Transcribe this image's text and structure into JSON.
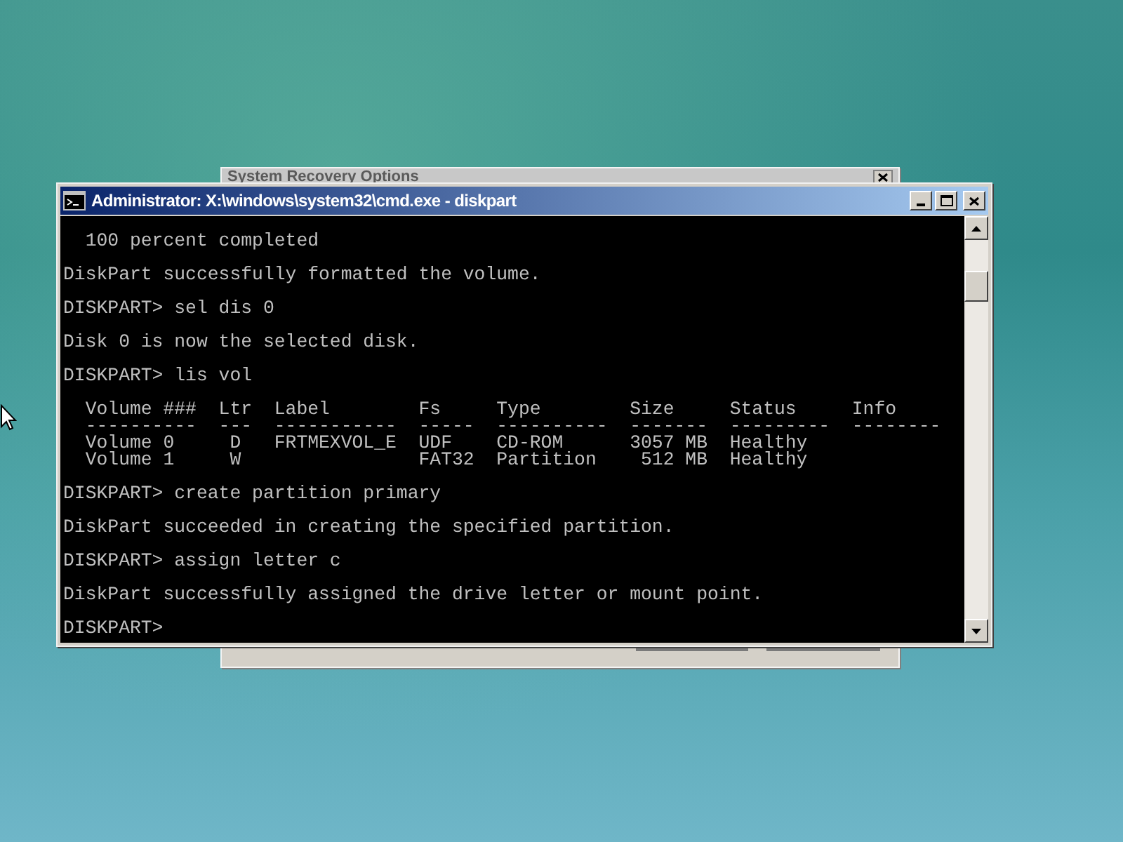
{
  "background_window": {
    "title": "System Recovery Options"
  },
  "console_window": {
    "title": "Administrator: X:\\windows\\system32\\cmd.exe - diskpart",
    "blocks": [
      [
        "  100 percent completed"
      ],
      [
        "DiskPart successfully formatted the volume."
      ],
      [
        "DISKPART> sel dis 0"
      ],
      [
        "Disk 0 is now the selected disk."
      ],
      [
        "DISKPART> lis vol"
      ],
      [
        "  Volume ###  Ltr  Label        Fs     Type        Size     Status     Info",
        "  ----------  ---  -----------  -----  ----------  -------  ---------  --------",
        "  Volume 0     D   FRTMEXVOL_E  UDF    CD-ROM      3057 MB  Healthy",
        "  Volume 1     W                FAT32  Partition    512 MB  Healthy"
      ],
      [
        "DISKPART> create partition primary"
      ],
      [
        "DiskPart succeeded in creating the specified partition."
      ],
      [
        "DISKPART> assign letter c"
      ],
      [
        "DiskPart successfully assigned the drive letter or mount point."
      ],
      [
        "DISKPART> "
      ]
    ]
  }
}
